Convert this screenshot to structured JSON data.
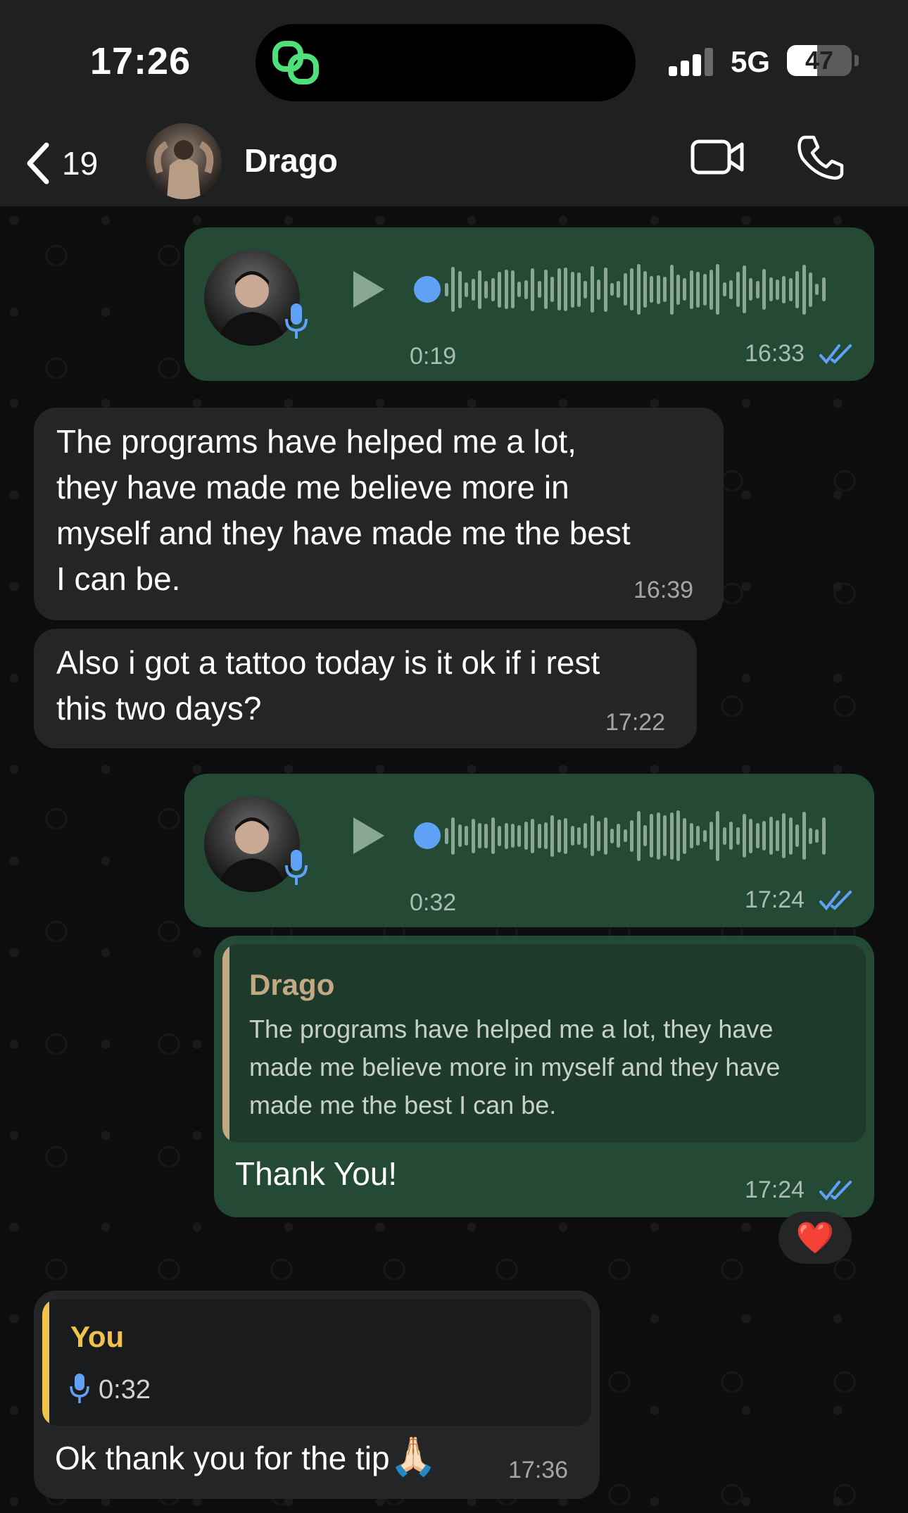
{
  "status": {
    "time": "17:26",
    "network": "5G",
    "battery": "47",
    "battery_level": 0.47
  },
  "header": {
    "back_count": "19",
    "contact_name": "Drago",
    "back_icon": "chevron-left-icon",
    "video_icon": "video-camera-icon",
    "call_icon": "phone-icon"
  },
  "messages": [
    {
      "type": "voice",
      "direction": "out",
      "duration": "0:19",
      "time": "16:33",
      "status": "read"
    },
    {
      "type": "text",
      "direction": "in",
      "lines": [
        "The programs have helped me a lot,",
        "they have made me believe more in",
        "myself and they have made me the best",
        "I can be."
      ],
      "time": "16:39"
    },
    {
      "type": "text",
      "direction": "in",
      "lines": [
        "Also i got a tattoo today is it ok if i rest",
        "this two days?"
      ],
      "time": "17:22"
    },
    {
      "type": "voice",
      "direction": "out",
      "duration": "0:32",
      "time": "17:24",
      "status": "read"
    },
    {
      "type": "reply",
      "direction": "out",
      "quote_author": "Drago",
      "quote_lines": [
        "The programs have helped me a lot, they have",
        "made me believe more in myself and they have",
        "made me the best I can be."
      ],
      "text": "Thank You!",
      "time": "17:24",
      "status": "read",
      "reaction": "❤️"
    },
    {
      "type": "reply",
      "direction": "in",
      "quote_author": "You",
      "quote_voice_duration": "0:32",
      "text": "Ok thank you for the tip",
      "emoji": "🙏🏻",
      "time": "17:36"
    }
  ],
  "colors": {
    "outgoing_bubble": "#244a36",
    "incoming_bubble": "#242526",
    "read_ticks": "#5fa2f5",
    "quote_drago": "#c2a983",
    "quote_you": "#f0c24b"
  }
}
